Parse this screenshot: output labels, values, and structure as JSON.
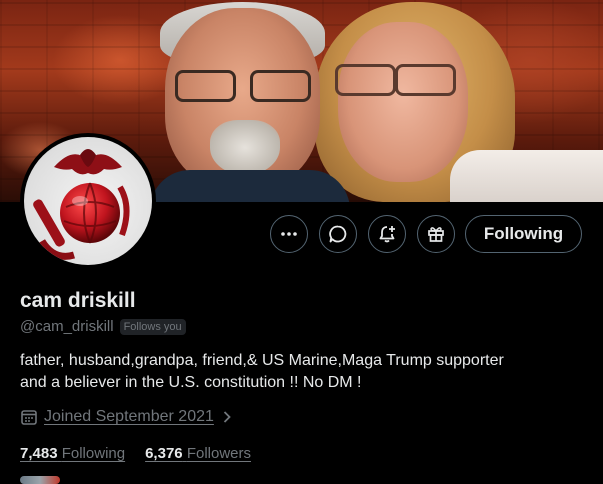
{
  "profile": {
    "name": "cam driskill",
    "handle": "@cam_driskill",
    "follows_you": "Follows you",
    "bio_line1": "father, husband,grandpa, friend,& US Marine,Maga Trump supporter",
    "bio_line2": "and a believer in the U.S. constitution !! No DM !",
    "joined": "Joined September 2021"
  },
  "actions": {
    "following_label": "Following",
    "more_icon": "more-horizontal-icon",
    "message_icon": "message-bubble-icon",
    "notify_icon": "bell-plus-icon",
    "gift_icon": "gift-icon"
  },
  "stats": {
    "following_count": "7,483",
    "following_label": "Following",
    "followers_count": "6,376",
    "followers_label": "Followers"
  },
  "colors": {
    "background": "#000000",
    "text_primary": "#e7e9ea",
    "text_secondary": "#71767b",
    "border": "#536471",
    "emblem_red": "#b4141e"
  }
}
